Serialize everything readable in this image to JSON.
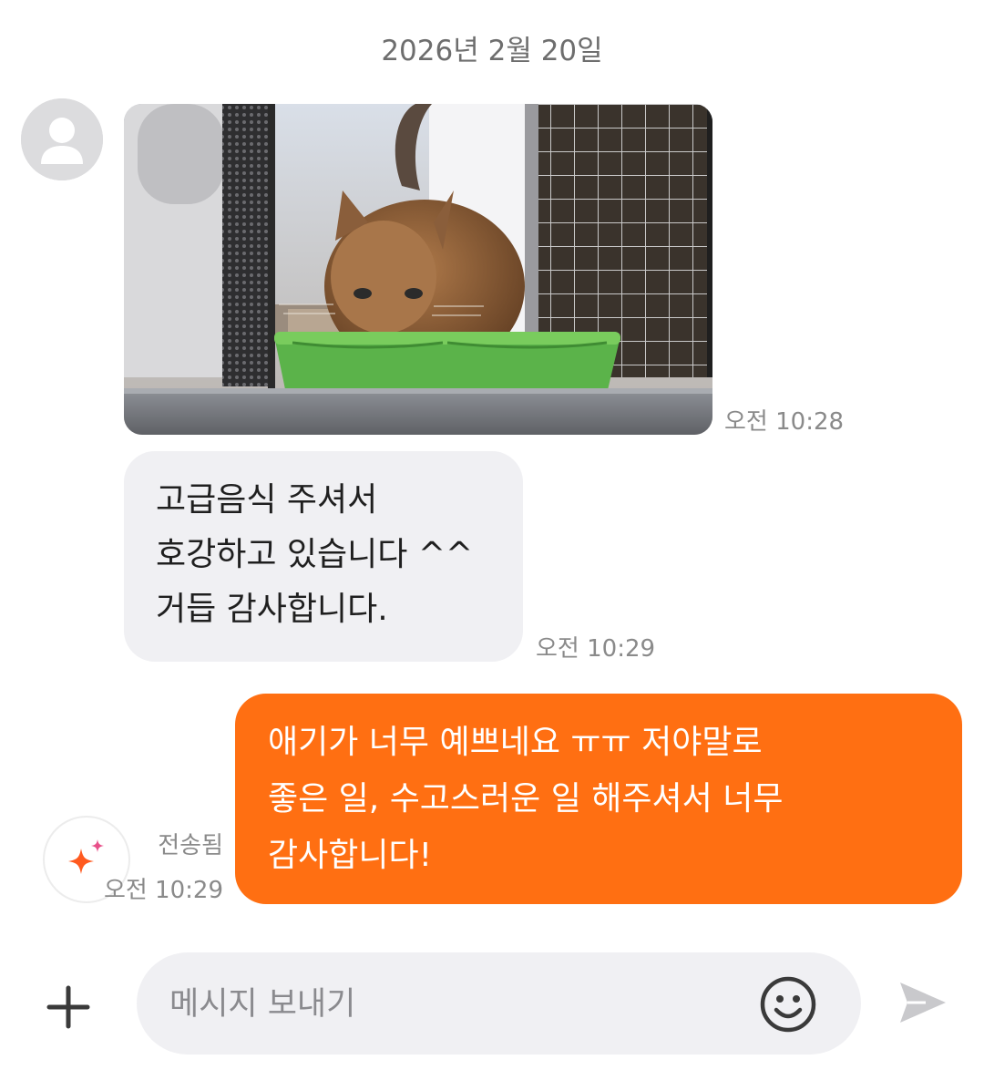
{
  "chat": {
    "date_separator": "2026년 2월 20일",
    "incoming": {
      "photo_time": "오전 10:28",
      "text_lines": [
        "고급음식 주셔서",
        "호강하고 있습니다 ^^",
        "거듭 감사합니다."
      ],
      "text_time": "오전 10:29"
    },
    "outgoing": {
      "text_lines": [
        "애기가 너무 예쁘네요 ㅠㅠ 저야말로",
        "좋은 일, 수고스러운 일 해주셔서 너무",
        "감사합니다!"
      ],
      "status": "전송됨",
      "time": "오전 10:29"
    }
  },
  "composer": {
    "placeholder": "메시지 보내기",
    "icons": [
      "plus-icon",
      "emoji-icon",
      "send-icon",
      "sparkle-icon"
    ]
  },
  "colors": {
    "outgoing_bubble": "#ff6f12",
    "incoming_bubble": "#f0f0f3",
    "timestamp": "#8a8a8a"
  }
}
